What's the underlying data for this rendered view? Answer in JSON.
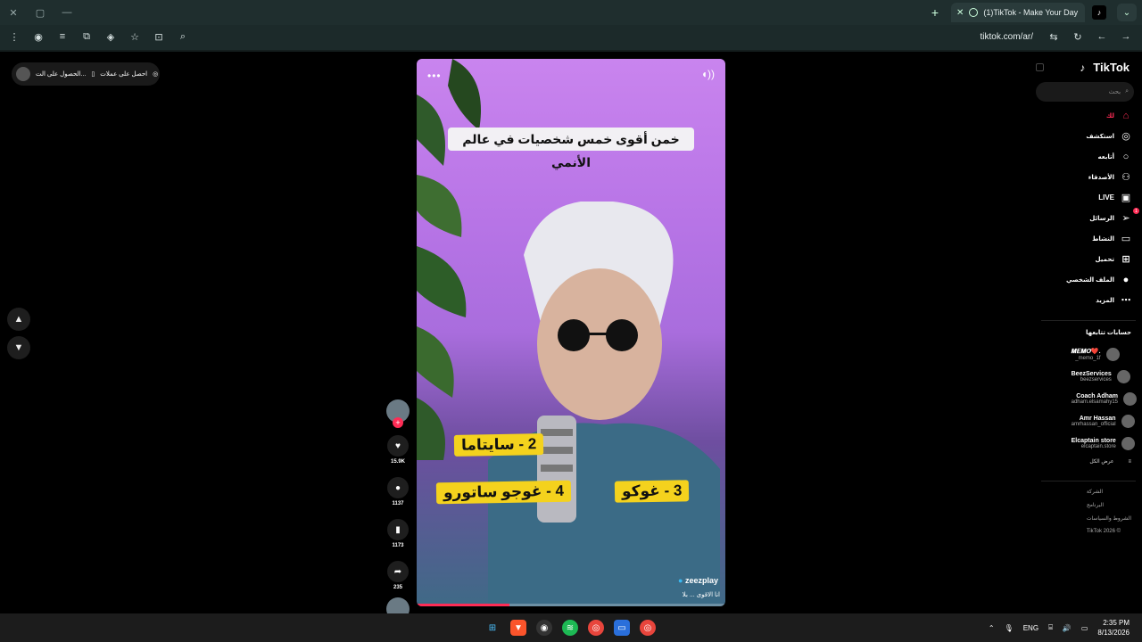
{
  "browser": {
    "tab_title": "(1)TikTok - Make Your Day",
    "url": "tiktok.com/ar/"
  },
  "page": {
    "promo_pill": {
      "left_text": "الحصول على الت...",
      "right_text": "احصل على عملات"
    },
    "video": {
      "caption": "خمن أقوى خمس شخصيات في عالم الأنمي",
      "tag_2": "2 - سايتاما",
      "tag_3": "3 - غوكو",
      "tag_4": "4 - غوجو ساتورو",
      "author": "zeezplay",
      "description": "انا الاقوى ... بلا",
      "progress": 0.3
    },
    "actions": {
      "likes": "15.9K",
      "comments": "1137",
      "saves": "1173",
      "shares": "235"
    },
    "sidebar": {
      "logo": "TikTok",
      "search_placeholder": "بحث",
      "menu": [
        {
          "label": "لك",
          "icon": "home-icon"
        },
        {
          "label": "استكشف",
          "icon": "compass-icon"
        },
        {
          "label": "أتابعه",
          "icon": "following-icon"
        },
        {
          "label": "الأصدقاء",
          "icon": "friends-icon"
        },
        {
          "label": "LIVE",
          "icon": "live-icon"
        },
        {
          "label": "الرسائل",
          "icon": "send-icon"
        },
        {
          "label": "النشاط",
          "icon": "activity-icon"
        },
        {
          "label": "تحميل",
          "icon": "upload-icon"
        },
        {
          "label": "الملف الشخصي",
          "icon": "profile-avatar"
        },
        {
          "label": "المزيد",
          "icon": "more-icon"
        }
      ],
      "messages_badge": "1",
      "following_title": "حسابات تتابعها",
      "following": [
        {
          "name": "𝑴𝑬𝑴𝑶❤️.",
          "user": "_memo_1f"
        },
        {
          "name": "BeezServices",
          "user": "beezservices"
        },
        {
          "name": "Coach Adham",
          "user": "adham.elsamahy15"
        },
        {
          "name": "Amr Hassan",
          "user": "amrhassan_official"
        },
        {
          "name": "Elcaptain store",
          "user": "elcaptain.store"
        }
      ],
      "show_all": "عرض الكل",
      "footer": [
        "الشركة",
        "البرنامج",
        "الشروط والسياسات",
        "© 2026 TikTok"
      ]
    }
  },
  "taskbar": {
    "lang": "ENG",
    "time": "2:35 PM",
    "date": "8/13/2026"
  }
}
